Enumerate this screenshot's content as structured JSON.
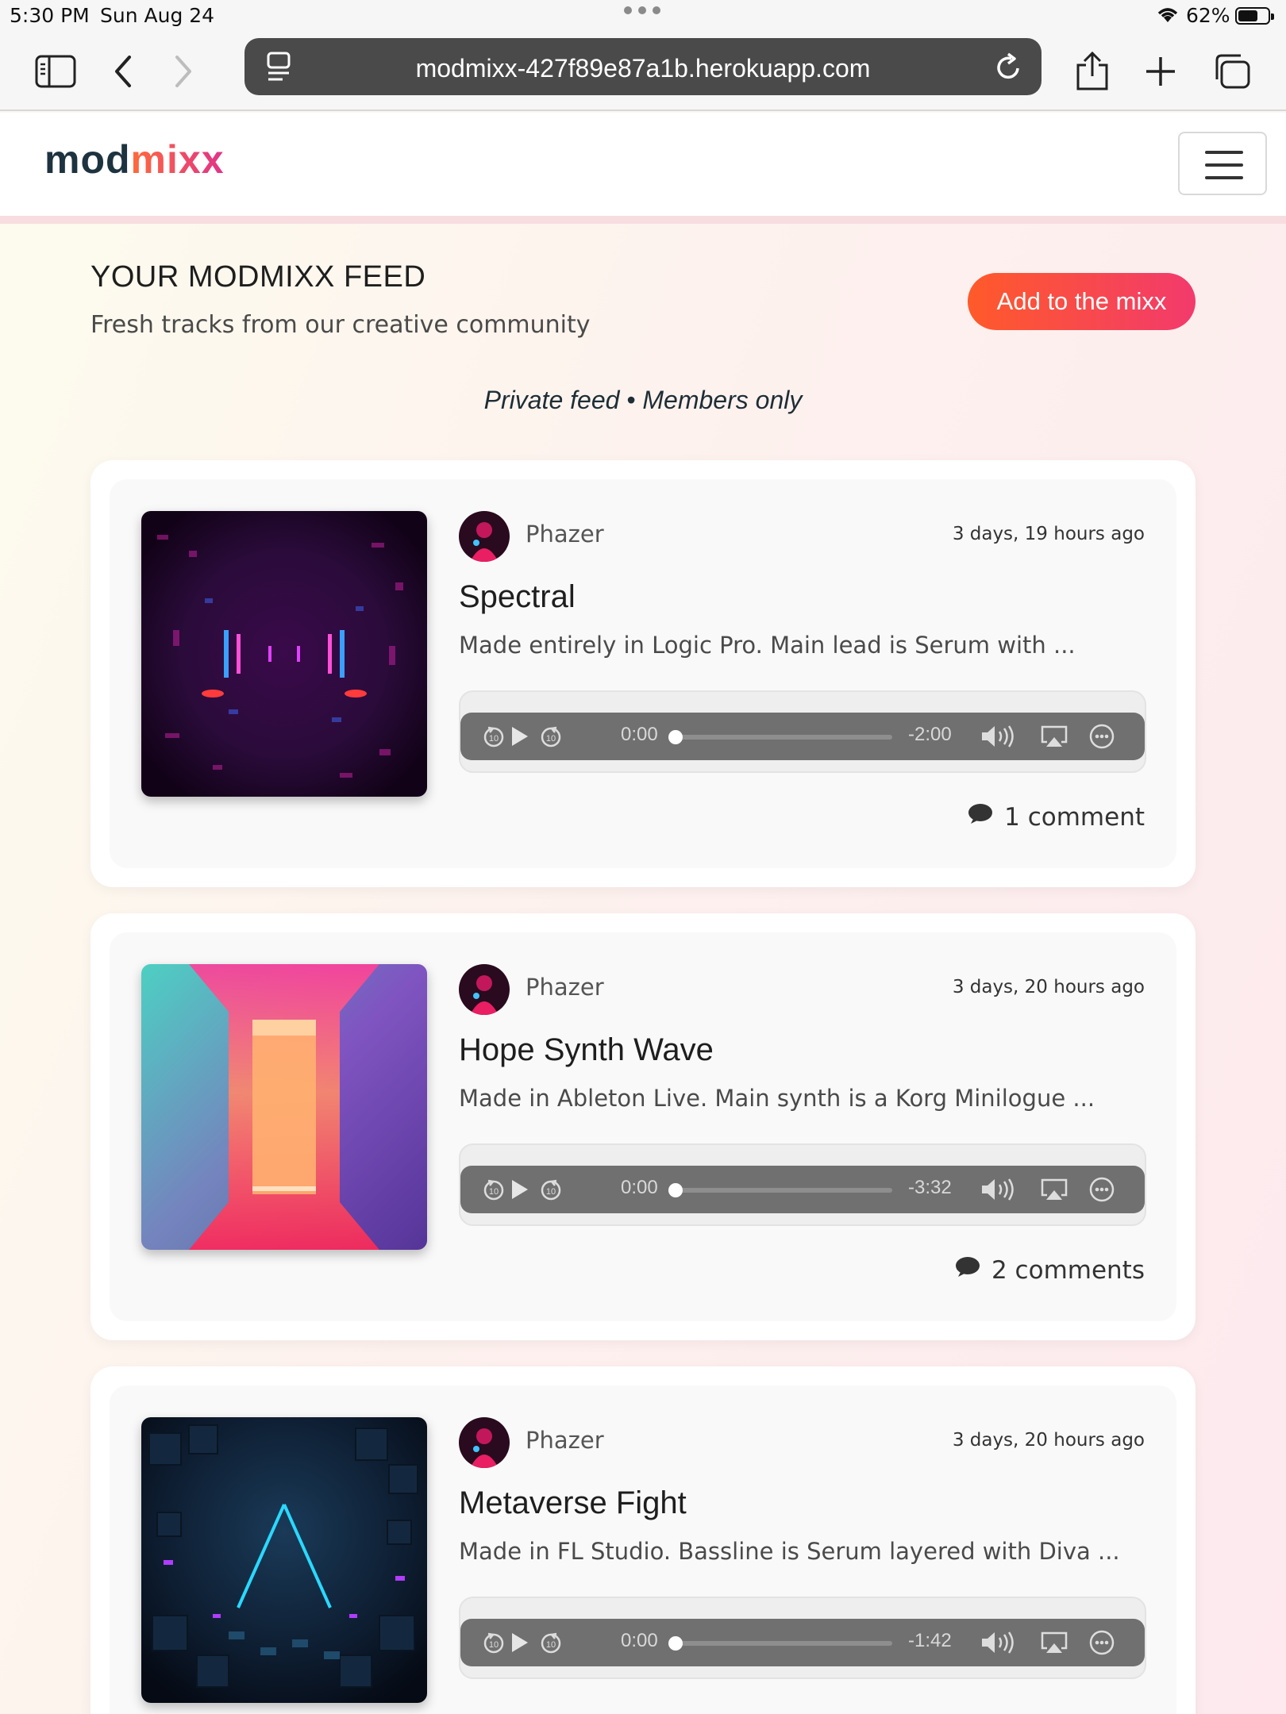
{
  "status_bar": {
    "time": "5:30 PM",
    "date": "Sun Aug 24",
    "battery": "62%"
  },
  "browser": {
    "url": "modmixx-427f89e87a1b.herokuapp.com"
  },
  "site": {
    "brand_part1": "mod",
    "brand_part2": "mixx",
    "brand_color": "#1e3340",
    "accent_gradient": [
      "#ff5a2a",
      "#f23a6c"
    ]
  },
  "feed": {
    "title": "YOUR MODMIXX FEED",
    "subtitle": "Fresh tracks from our creative community",
    "add_button": "Add to the mixx",
    "private_note": "Private feed • Members only"
  },
  "tracks": [
    {
      "author": "Phazer",
      "timestamp": "3 days, 19 hours ago",
      "title": "Spectral",
      "description": "Made entirely in Logic Pro. Main lead is Serum with ...",
      "current_time": "0:00",
      "remaining": "-2:00",
      "comments": "1 comment"
    },
    {
      "author": "Phazer",
      "timestamp": "3 days, 20 hours ago",
      "title": "Hope Synth Wave",
      "description": "Made in Ableton Live. Main synth is a Korg Minilogue ...",
      "current_time": "0:00",
      "remaining": "-3:32",
      "comments": "2 comments"
    },
    {
      "author": "Phazer",
      "timestamp": "3 days, 20 hours ago",
      "title": "Metaverse Fight",
      "description": "Made in FL Studio. Bassline is Serum layered with Diva ...",
      "current_time": "0:00",
      "remaining": "-1:42",
      "comments": ""
    }
  ]
}
